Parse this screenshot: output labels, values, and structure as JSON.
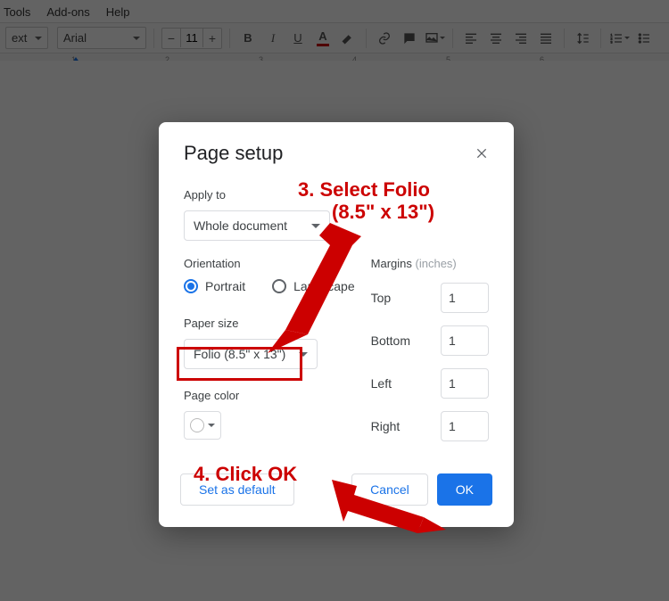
{
  "menubar": {
    "tools": "Tools",
    "addons": "Add-ons",
    "help": "Help"
  },
  "toolbar": {
    "style_label": "ext",
    "font_label": "Arial",
    "font_size": "11",
    "icons": {
      "bold": "B",
      "italic": "I",
      "underline": "U",
      "text_color_letter": "A"
    }
  },
  "ruler": {
    "marks": [
      "1",
      "2",
      "3",
      "4",
      "5",
      "6"
    ]
  },
  "dialog": {
    "title": "Page setup",
    "apply_to_label": "Apply to",
    "apply_to_value": "Whole document",
    "orientation_label": "Orientation",
    "orientation_portrait": "Portrait",
    "orientation_landscape": "Landscape",
    "paper_size_label": "Paper size",
    "paper_size_value": "Folio (8.5\" x 13\")",
    "page_color_label": "Page color",
    "margins_label": "Margins",
    "margins_unit": "(inches)",
    "margin_top_label": "Top",
    "margin_top": "1",
    "margin_bottom_label": "Bottom",
    "margin_bottom": "1",
    "margin_left_label": "Left",
    "margin_left": "1",
    "margin_right_label": "Right",
    "margin_right": "1",
    "set_default": "Set as default",
    "cancel": "Cancel",
    "ok": "OK"
  },
  "annotations": {
    "step3a": "3. Select Folio",
    "step3b": "(8.5\" x 13\")",
    "step4": "4. Click OK"
  }
}
